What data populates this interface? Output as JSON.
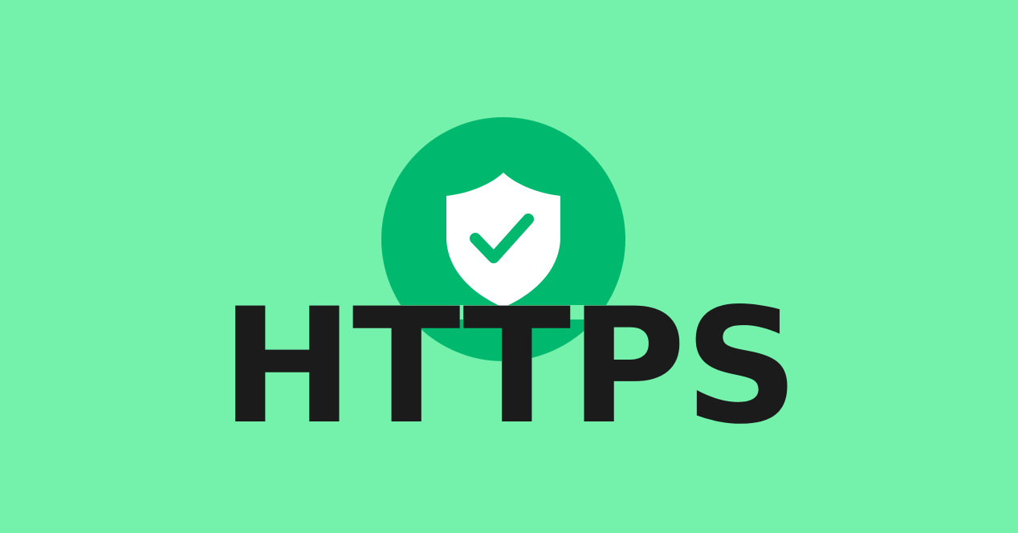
{
  "logo": {
    "wordmark": "HTTPS",
    "badge_icon": "shield-check-icon"
  },
  "colors": {
    "background": "#74F1AA",
    "badge_circle": "#00B96F",
    "shield_fill": "#FFFFFF",
    "checkmark": "#00B96F",
    "wordmark_text": "#1B1B1B"
  }
}
